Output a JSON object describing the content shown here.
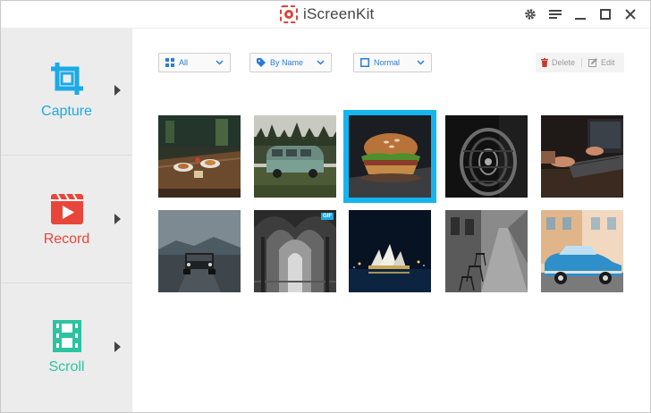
{
  "app": {
    "title": "iScreenKit"
  },
  "title_controls": [
    {
      "name": "settings-gear-icon"
    },
    {
      "name": "menu-icon"
    },
    {
      "name": "minimize-icon"
    },
    {
      "name": "maximize-icon"
    },
    {
      "name": "close-icon"
    }
  ],
  "sidebar": {
    "items": [
      {
        "label": "Capture",
        "icon": "crop-icon",
        "color": "#1aaae6"
      },
      {
        "label": "Record",
        "icon": "video-record-icon",
        "color": "#e8463a"
      },
      {
        "label": "Scroll",
        "icon": "scroll-film-icon",
        "color": "#2ec3a0"
      }
    ]
  },
  "toolbar": {
    "filter": {
      "label": "All",
      "icon": "grid-icon"
    },
    "sort": {
      "label": "By Name",
      "icon": "tag-icon"
    },
    "view": {
      "label": "Normal",
      "icon": "square-icon"
    },
    "delete_label": "Delete",
    "edit_label": "Edit"
  },
  "gallery": {
    "selected_index": 2,
    "items": [
      {
        "subject": "restaurant-table",
        "badge": ""
      },
      {
        "subject": "green-van",
        "badge": ""
      },
      {
        "subject": "burger",
        "badge": ""
      },
      {
        "subject": "spiral-staircase",
        "badge": ""
      },
      {
        "subject": "laptop-hands",
        "badge": ""
      },
      {
        "subject": "dark-jeep",
        "badge": ""
      },
      {
        "subject": "cathedral-arches",
        "badge": "GIF"
      },
      {
        "subject": "opera-house-night",
        "badge": ""
      },
      {
        "subject": "cobblestone-street",
        "badge": ""
      },
      {
        "subject": "blue-vintage-car",
        "badge": ""
      }
    ]
  },
  "colors": {
    "accent": "#1aaae6",
    "dropdown_text": "#2b7bd8",
    "record": "#e8463a",
    "scroll": "#2ec3a0",
    "selection": "#14b5ee"
  }
}
